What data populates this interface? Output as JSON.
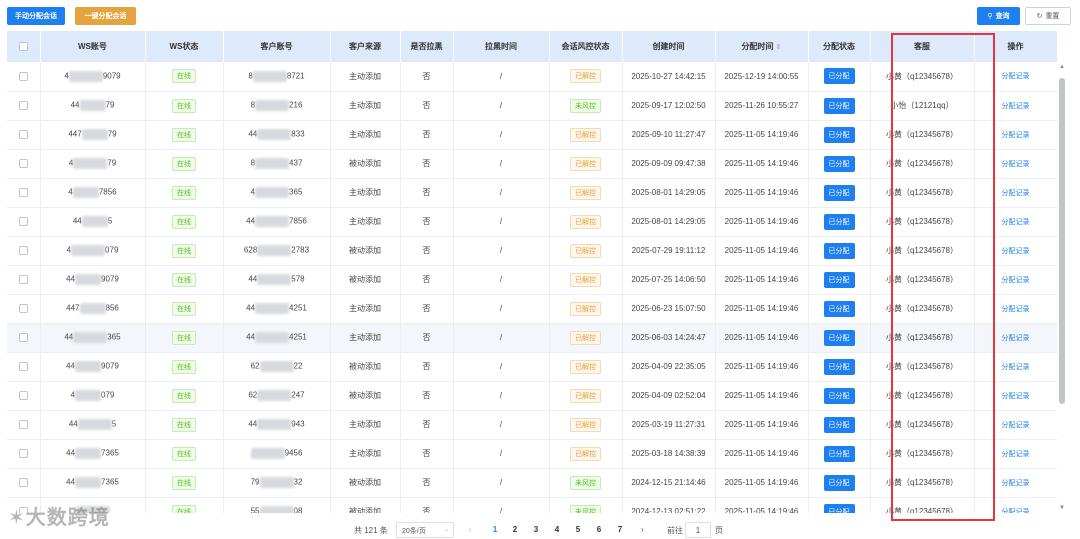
{
  "toolbar": {
    "manual_assign": "手动分配会话",
    "auto_assign": "一键分配会话",
    "search": "查询",
    "reset": "重置",
    "search_icon": "search-icon",
    "reset_icon": "refresh-icon"
  },
  "columns": [
    "WS账号",
    "WS状态",
    "客户账号",
    "客户来源",
    "是否拉黑",
    "拉黑时间",
    "会话风控状态",
    "创建时间",
    "分配时间",
    "分配状态",
    "客服",
    "操作"
  ],
  "rows": [
    {
      "ws_a": "4",
      "ws_b": "9079",
      "status": "在线",
      "cust_a": "8",
      "cust_b": "8721",
      "source": "主动添加",
      "blocked": "否",
      "block_time": "/",
      "risk": "已解控",
      "created": "2025-10-27 14:42:15",
      "assigned": "2025-12-19 14:00:55",
      "assign_state": "已分配",
      "agent": "小黄（q12345678）",
      "action": "分配记录"
    },
    {
      "ws_a": "44",
      "ws_b": "79",
      "status": "在线",
      "cust_a": "8",
      "cust_b": "216",
      "source": "主动添加",
      "blocked": "否",
      "block_time": "/",
      "risk": "未风控",
      "created": "2025-09-17 12:02:50",
      "assigned": "2025-11-26 10:55:27",
      "assign_state": "已分配",
      "agent": "小怡（12121qq）",
      "action": "分配记录"
    },
    {
      "ws_a": "447",
      "ws_b": "79",
      "status": "在线",
      "cust_a": "44",
      "cust_b": "833",
      "source": "主动添加",
      "blocked": "否",
      "block_time": "/",
      "risk": "已解控",
      "created": "2025-09-10 11:27:47",
      "assigned": "2025-11-05 14:19:46",
      "assign_state": "已分配",
      "agent": "小黄（q12345678）",
      "action": "分配记录"
    },
    {
      "ws_a": "4",
      "ws_b": "79",
      "status": "在线",
      "cust_a": "8",
      "cust_b": "437",
      "source": "被动添加",
      "blocked": "否",
      "block_time": "/",
      "risk": "已解控",
      "created": "2025-09-09 09:47:38",
      "assigned": "2025-11-05 14:19:46",
      "assign_state": "已分配",
      "agent": "小黄（q12345678）",
      "action": "分配记录"
    },
    {
      "ws_a": "4",
      "ws_b": "7856",
      "status": "在线",
      "cust_a": "4",
      "cust_b": "365",
      "source": "主动添加",
      "blocked": "否",
      "block_time": "/",
      "risk": "已解控",
      "created": "2025-08-01 14:29:05",
      "assigned": "2025-11-05 14:19:46",
      "assign_state": "已分配",
      "agent": "小黄（q12345678）",
      "action": "分配记录"
    },
    {
      "ws_a": "44",
      "ws_b": "5",
      "status": "在线",
      "cust_a": "44",
      "cust_b": "7856",
      "source": "主动添加",
      "blocked": "否",
      "block_time": "/",
      "risk": "已解控",
      "created": "2025-08-01 14:29:05",
      "assigned": "2025-11-05 14:19:46",
      "assign_state": "已分配",
      "agent": "小黄（q12345678）",
      "action": "分配记录"
    },
    {
      "ws_a": "4",
      "ws_b": "079",
      "status": "在线",
      "cust_a": "628",
      "cust_b": "2783",
      "source": "被动添加",
      "blocked": "否",
      "block_time": "/",
      "risk": "已解控",
      "created": "2025-07-29 19:11:12",
      "assigned": "2025-11-05 14:19:46",
      "assign_state": "已分配",
      "agent": "小黄（q12345678）",
      "action": "分配记录"
    },
    {
      "ws_a": "44",
      "ws_b": "9079",
      "status": "在线",
      "cust_a": "44",
      "cust_b": "578",
      "source": "被动添加",
      "blocked": "否",
      "block_time": "/",
      "risk": "已解控",
      "created": "2025-07-25 14:06:50",
      "assigned": "2025-11-05 14:19:46",
      "assign_state": "已分配",
      "agent": "小黄（q12345678）",
      "action": "分配记录"
    },
    {
      "ws_a": "447",
      "ws_b": "856",
      "status": "在线",
      "cust_a": "44",
      "cust_b": "4251",
      "source": "主动添加",
      "blocked": "否",
      "block_time": "/",
      "risk": "已解控",
      "created": "2025-06-23 15:07:50",
      "assigned": "2025-11-05 14:19:46",
      "assign_state": "已分配",
      "agent": "小黄（q12345678）",
      "action": "分配记录"
    },
    {
      "ws_a": "44",
      "ws_b": "365",
      "status": "在线",
      "cust_a": "44",
      "cust_b": "4251",
      "source": "主动添加",
      "blocked": "否",
      "block_time": "/",
      "risk": "已解控",
      "created": "2025-06-03 14:24:47",
      "assigned": "2025-11-05 14:19:46",
      "assign_state": "已分配",
      "agent": "小黄（q12345678）",
      "action": "分配记录"
    },
    {
      "ws_a": "44",
      "ws_b": "9079",
      "status": "在线",
      "cust_a": "62",
      "cust_b": "22",
      "source": "被动添加",
      "blocked": "否",
      "block_time": "/",
      "risk": "已解控",
      "created": "2025-04-09 22:35:05",
      "assigned": "2025-11-05 14:19:46",
      "assign_state": "已分配",
      "agent": "小黄（q12345678）",
      "action": "分配记录"
    },
    {
      "ws_a": "4",
      "ws_b": "079",
      "status": "在线",
      "cust_a": "62",
      "cust_b": "247",
      "source": "被动添加",
      "blocked": "否",
      "block_time": "/",
      "risk": "已解控",
      "created": "2025-04-09 02:52:04",
      "assigned": "2025-11-05 14:19:46",
      "assign_state": "已分配",
      "agent": "小黄（q12345678）",
      "action": "分配记录"
    },
    {
      "ws_a": "44",
      "ws_b": "5",
      "status": "在线",
      "cust_a": "44",
      "cust_b": "943",
      "source": "主动添加",
      "blocked": "否",
      "block_time": "/",
      "risk": "已解控",
      "created": "2025-03-19 11:27:31",
      "assigned": "2025-11-05 14:19:46",
      "assign_state": "已分配",
      "agent": "小黄（q12345678）",
      "action": "分配记录"
    },
    {
      "ws_a": "44",
      "ws_b": "7365",
      "status": "在线",
      "cust_a": "",
      "cust_b": "9456",
      "source": "主动添加",
      "blocked": "否",
      "block_time": "/",
      "risk": "已解控",
      "created": "2025-03-18 14:38:39",
      "assigned": "2025-11-05 14:19:46",
      "assign_state": "已分配",
      "agent": "小黄（q12345678）",
      "action": "分配记录"
    },
    {
      "ws_a": "44",
      "ws_b": "7365",
      "status": "在线",
      "cust_a": "79",
      "cust_b": "32",
      "source": "被动添加",
      "blocked": "否",
      "block_time": "/",
      "risk": "未风控",
      "created": "2024-12-15 21:14:46",
      "assigned": "2025-11-05 14:19:46",
      "assign_state": "已分配",
      "agent": "小黄（q12345678）",
      "action": "分配记录"
    },
    {
      "ws_a": "",
      "ws_b": "",
      "status": "在线",
      "cust_a": "55",
      "cust_b": "08",
      "source": "被动添加",
      "blocked": "否",
      "block_time": "/",
      "risk": "未风控",
      "created": "2024-12-13 02:51:22",
      "assigned": "2025-11-05 14:19:46",
      "assign_state": "已分配",
      "agent": "小黄（q12345678）",
      "action": "分配记录"
    }
  ],
  "pagination": {
    "total": "共 121 条",
    "page_size": "20条/页",
    "pages": [
      "1",
      "2",
      "3",
      "4",
      "5",
      "6",
      "7"
    ],
    "current": "1",
    "goto_label": "前往",
    "goto_value": "1",
    "page_unit": "页"
  },
  "watermark": "大数跨境",
  "colors": {
    "primary": "#1e7ff0",
    "highlight_box": "#e8353b",
    "header_bg": "#ddeafc"
  }
}
